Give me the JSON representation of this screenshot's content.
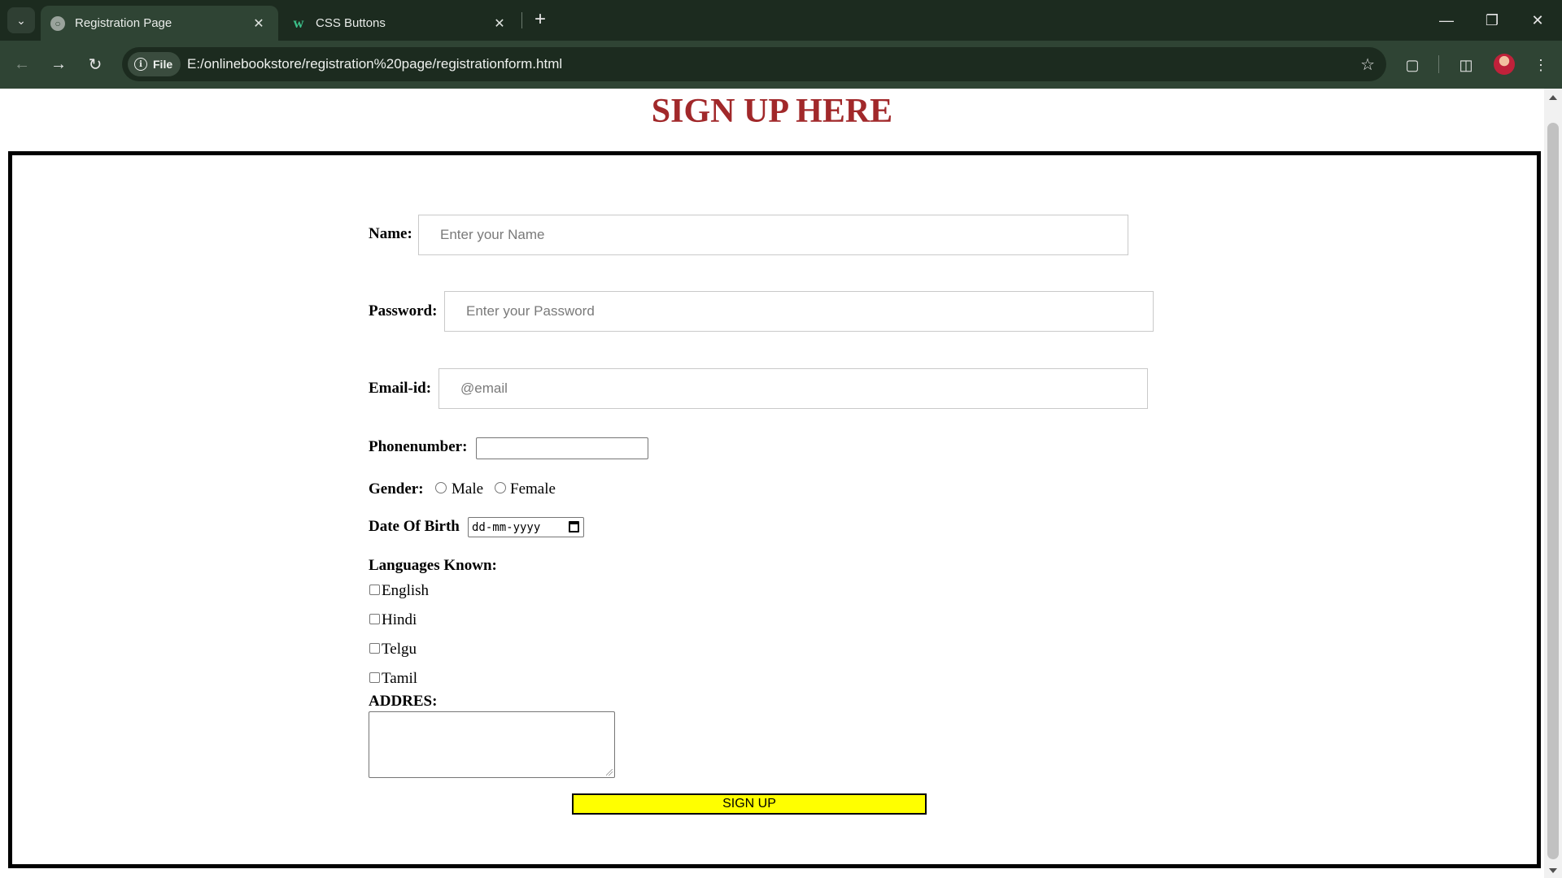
{
  "browser": {
    "tabs": [
      {
        "title": "Registration Page",
        "icon": "globe-icon",
        "active": true
      },
      {
        "title": "CSS Buttons",
        "icon": "w3schools-icon",
        "active": false
      }
    ],
    "new_tab_label": "+",
    "address": {
      "scheme_chip": "File",
      "url": "E:/onlinebookstore/registration%20page/registrationform.html"
    },
    "accent": "#2f4434"
  },
  "page": {
    "heading": "SIGN UP HERE",
    "heading_color": "#a1282a",
    "fields": {
      "name": {
        "label": "Name:",
        "placeholder": "Enter your Name",
        "value": ""
      },
      "password": {
        "label": "Password:",
        "placeholder": "Enter your Password",
        "value": ""
      },
      "email": {
        "label": "Email-id:",
        "placeholder": "@email",
        "value": ""
      },
      "phone": {
        "label": "Phonenumber:",
        "value": ""
      },
      "gender": {
        "label": "Gender:",
        "options": [
          "Male",
          "Female"
        ],
        "selected": null
      },
      "dob": {
        "label": "Date Of Birth",
        "placeholder": "dd-mm-yyyy"
      },
      "languages": {
        "label": "Languages Known:",
        "options": [
          "English",
          "Hindi",
          "Telgu",
          "Tamil"
        ],
        "checked": []
      },
      "address": {
        "label": "ADDRES:",
        "value": ""
      }
    },
    "submit_label": "SIGN UP",
    "submit_color": "#ffff00"
  }
}
